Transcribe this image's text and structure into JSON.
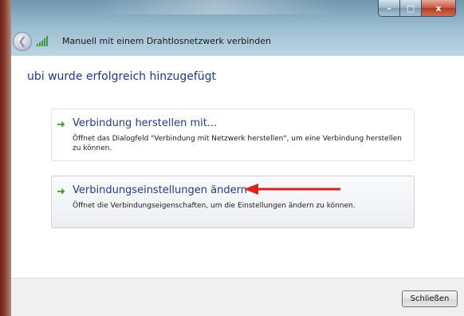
{
  "window": {
    "title": "Manuell mit einem Drahtlosnetzwerk verbinden",
    "caption_minimize": "–",
    "caption_maximize": "□",
    "caption_close": "x"
  },
  "heading": "ubi wurde erfolgreich hinzugefügt",
  "options": [
    {
      "title": "Verbindung herstellen mit...",
      "description": "Öffnet das Dialogfeld \"Verbindung mit Netzwerk herstellen\", um eine Verbindung herstellen zu können.",
      "icon": "green-arrow-icon"
    },
    {
      "title": "Verbindungseinstellungen ändern",
      "description": "Öffnet die Verbindungseigenschaften, um die Einstellungen ändern zu können.",
      "icon": "green-arrow-icon"
    }
  ],
  "footer": {
    "close_label": "Schließen"
  },
  "colors": {
    "link_blue": "#1f3c8e",
    "heading_blue": "#1c3a8c",
    "arrow_green": "#2e9a2a",
    "annotation_red": "#e0201b"
  }
}
